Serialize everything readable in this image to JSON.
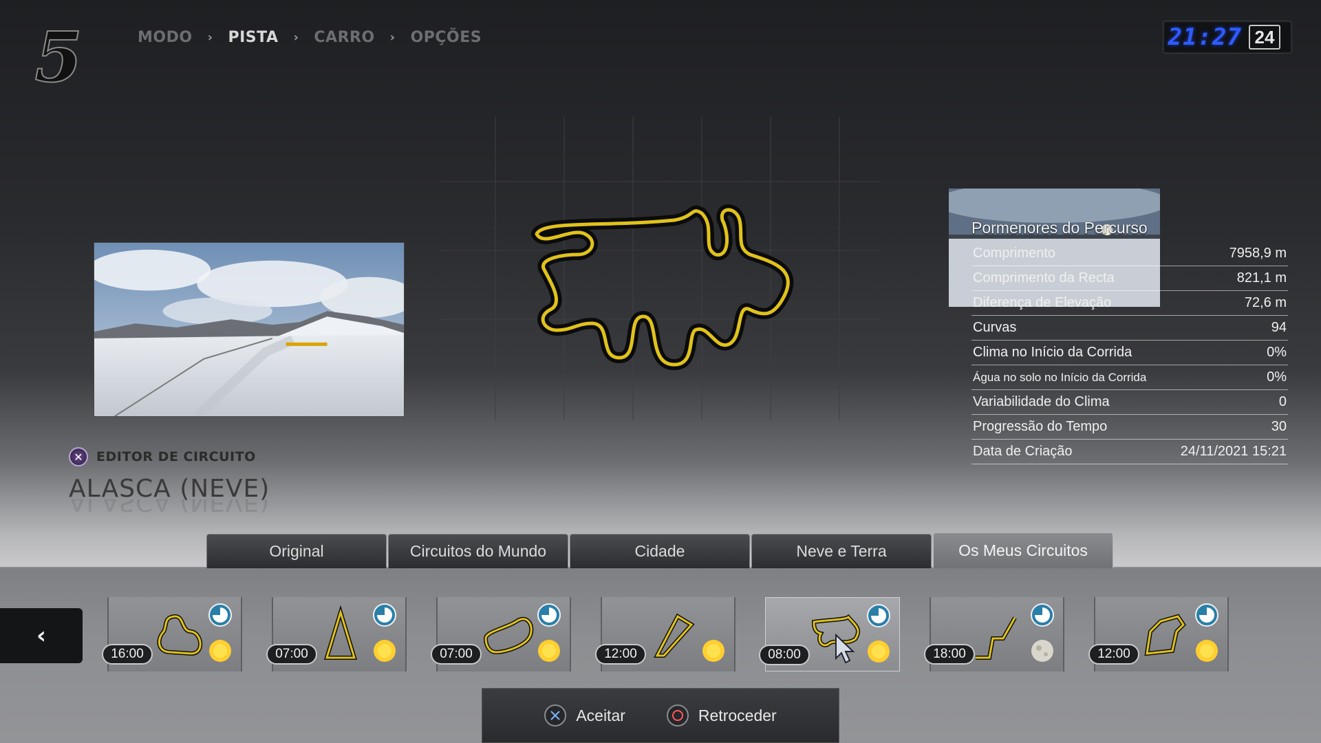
{
  "header": {
    "logo_text": "5",
    "breadcrumb": [
      "MODO",
      "PISTA",
      "CARRO",
      "OPÇÕES"
    ],
    "breadcrumb_sep": "›",
    "clock_time": "21:27",
    "clock_day": "24"
  },
  "editor": {
    "label": "EDITOR DE CIRCUITO",
    "track_name": "ALASCA (NEVE)"
  },
  "details": {
    "title": "Pormenores do Percurso",
    "rows": [
      {
        "label": "Comprimento",
        "value": "7958,9 m"
      },
      {
        "label": "Comprimento da Recta",
        "value": "821,1 m"
      },
      {
        "label": "Diferença de Elevação",
        "value": "72,6 m"
      },
      {
        "label": "Curvas",
        "value": "94"
      },
      {
        "label": "Clima no Início da Corrida",
        "value": "0%"
      },
      {
        "label": "Água no solo no Início da Corrida",
        "value": "0%"
      },
      {
        "label": "Variabilidade do Clima",
        "value": "0"
      },
      {
        "label": "Progressão do Tempo",
        "value": "30"
      },
      {
        "label": "Data de Criação",
        "value": "24/11/2021 15:21"
      }
    ]
  },
  "tabs": [
    {
      "label": "Original"
    },
    {
      "label": "Circuitos do Mundo"
    },
    {
      "label": "Cidade"
    },
    {
      "label": "Neve e Terra"
    },
    {
      "label": "Os Meus Circuitos",
      "active": true
    }
  ],
  "tracks": [
    {
      "time": "16:00",
      "weather": "sun"
    },
    {
      "time": "07:00",
      "weather": "sun"
    },
    {
      "time": "07:00",
      "weather": "sun"
    },
    {
      "time": "12:00",
      "weather": "sun"
    },
    {
      "time": "08:00",
      "weather": "sun",
      "selected": true
    },
    {
      "time": "18:00",
      "weather": "moon"
    },
    {
      "time": "12:00",
      "weather": "sun"
    }
  ],
  "actions": {
    "accept": "Aceitar",
    "back": "Retroceder"
  },
  "colors": {
    "track_line": "#e0c21c",
    "clock_digits": "#2e5cff"
  }
}
